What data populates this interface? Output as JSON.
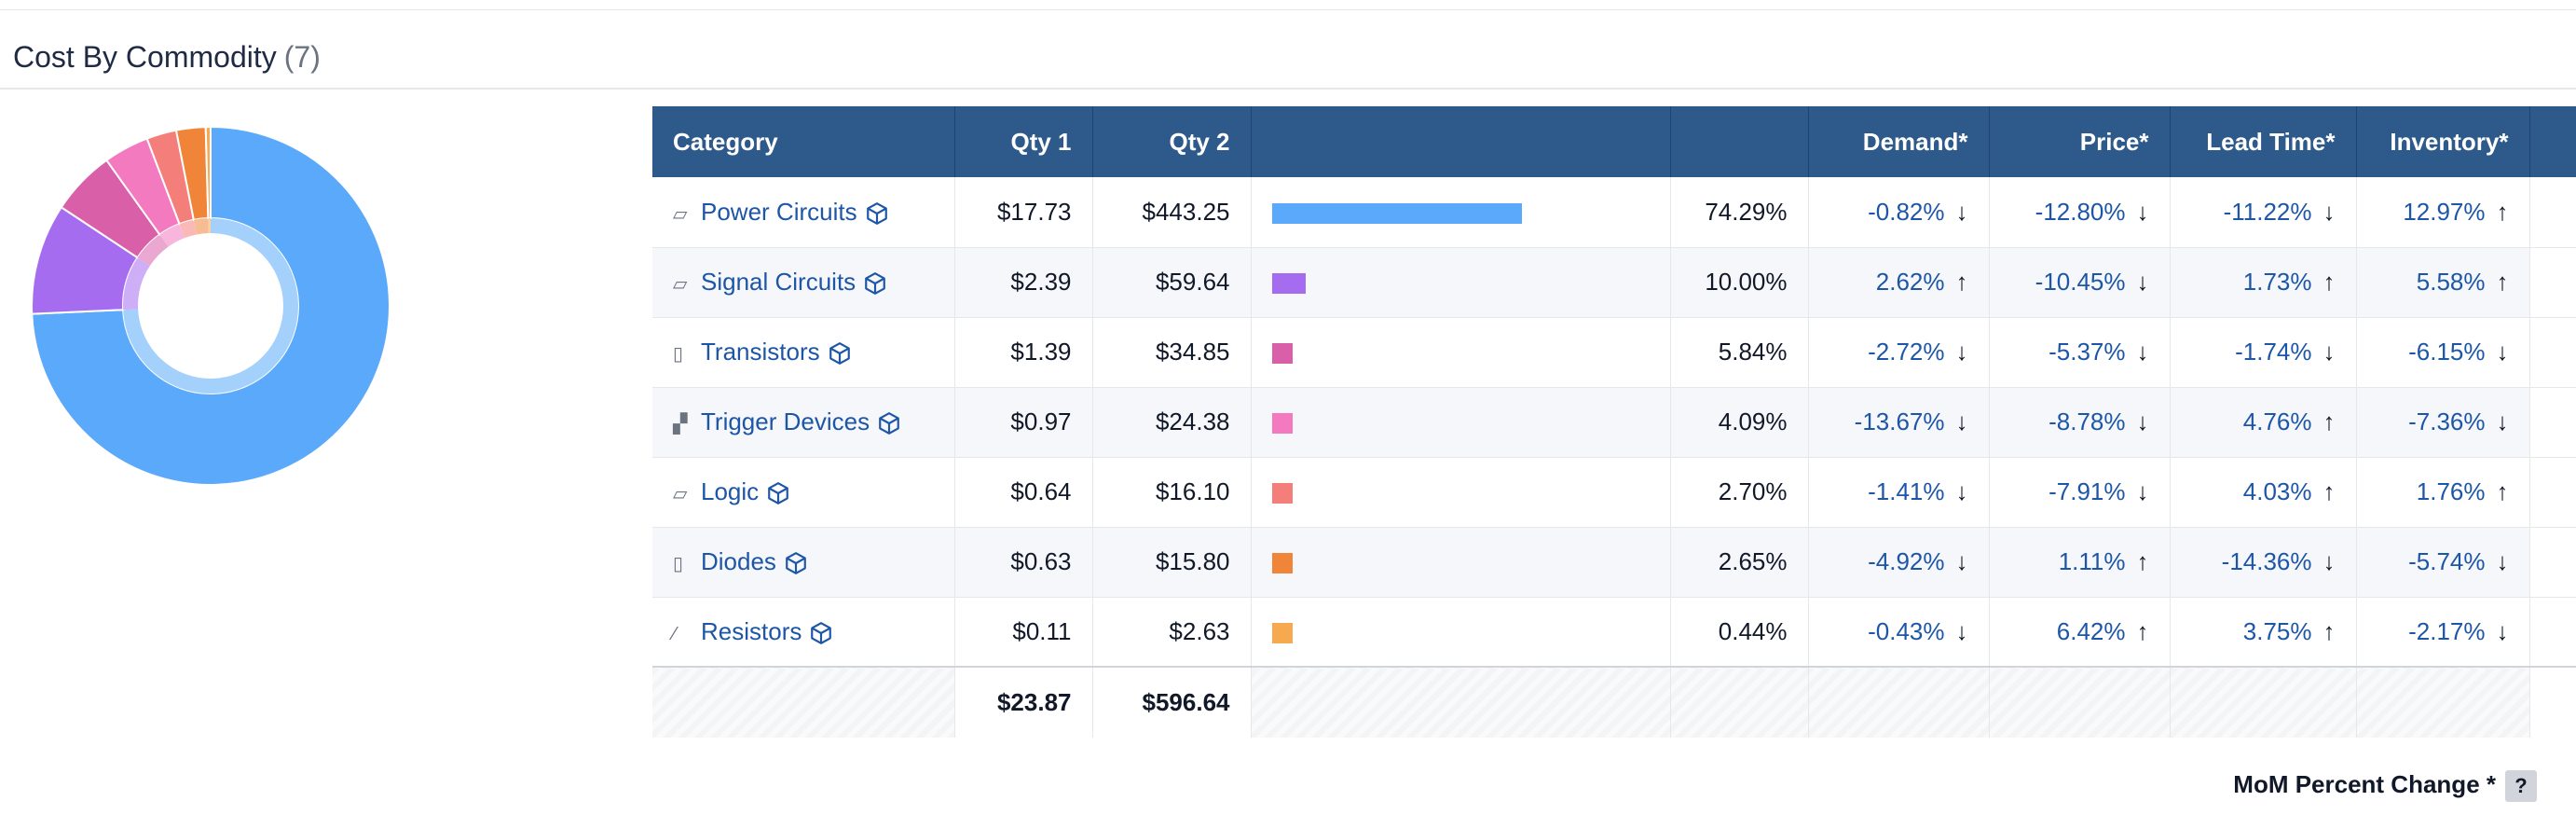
{
  "header": {
    "title": "Cost By Commodity",
    "count": "(7)"
  },
  "colors": {
    "header_bg": "#2d5a8a",
    "link": "#1d56a6",
    "series": [
      "#5aa9fa",
      "#a66cf0",
      "#d95fa8",
      "#f47ac0",
      "#f47f7a",
      "#f0853a",
      "#f6a94f"
    ]
  },
  "table": {
    "columns": [
      "Category",
      "Qty 1",
      "Qty 2",
      "",
      "",
      "Demand*",
      "Price*",
      "Lead Time*",
      "Inventory*"
    ],
    "rows": [
      {
        "icon": "power-circuit-icon",
        "glyph": "▱",
        "category": "Power Circuits",
        "qty1": "$17.73",
        "qty2": "$443.25",
        "share": 0.7429,
        "pct": "74.29%",
        "demand": "-0.82%",
        "demand_dir": "↓",
        "price": "-12.80%",
        "price_dir": "↓",
        "lead": "-11.22%",
        "lead_dir": "↓",
        "inventory": "12.97%",
        "inventory_dir": "↑"
      },
      {
        "icon": "signal-circuit-icon",
        "glyph": "▱",
        "category": "Signal Circuits",
        "qty1": "$2.39",
        "qty2": "$59.64",
        "share": 0.1,
        "pct": "10.00%",
        "demand": "2.62%",
        "demand_dir": "↑",
        "price": "-10.45%",
        "price_dir": "↓",
        "lead": "1.73%",
        "lead_dir": "↑",
        "inventory": "5.58%",
        "inventory_dir": "↑"
      },
      {
        "icon": "transistor-icon",
        "glyph": "▯",
        "category": "Transistors",
        "qty1": "$1.39",
        "qty2": "$34.85",
        "share": 0.0584,
        "pct": "5.84%",
        "demand": "-2.72%",
        "demand_dir": "↓",
        "price": "-5.37%",
        "price_dir": "↓",
        "lead": "-1.74%",
        "lead_dir": "↓",
        "inventory": "-6.15%",
        "inventory_dir": "↓"
      },
      {
        "icon": "trigger-device-icon",
        "glyph": "▞",
        "category": "Trigger Devices",
        "qty1": "$0.97",
        "qty2": "$24.38",
        "share": 0.0409,
        "pct": "4.09%",
        "demand": "-13.67%",
        "demand_dir": "↓",
        "price": "-8.78%",
        "price_dir": "↓",
        "lead": "4.76%",
        "lead_dir": "↑",
        "inventory": "-7.36%",
        "inventory_dir": "↓"
      },
      {
        "icon": "logic-icon",
        "glyph": "▱",
        "category": "Logic",
        "qty1": "$0.64",
        "qty2": "$16.10",
        "share": 0.027,
        "pct": "2.70%",
        "demand": "-1.41%",
        "demand_dir": "↓",
        "price": "-7.91%",
        "price_dir": "↓",
        "lead": "4.03%",
        "lead_dir": "↑",
        "inventory": "1.76%",
        "inventory_dir": "↑"
      },
      {
        "icon": "diode-icon",
        "glyph": "▯",
        "category": "Diodes",
        "qty1": "$0.63",
        "qty2": "$15.80",
        "share": 0.0265,
        "pct": "2.65%",
        "demand": "-4.92%",
        "demand_dir": "↓",
        "price": "1.11%",
        "price_dir": "↑",
        "lead": "-14.36%",
        "lead_dir": "↓",
        "inventory": "-5.74%",
        "inventory_dir": "↓"
      },
      {
        "icon": "resistor-icon",
        "glyph": "⁄",
        "category": "Resistors",
        "qty1": "$0.11",
        "qty2": "$2.63",
        "share": 0.0044,
        "pct": "0.44%",
        "demand": "-0.43%",
        "demand_dir": "↓",
        "price": "6.42%",
        "price_dir": "↑",
        "lead": "3.75%",
        "lead_dir": "↑",
        "inventory": "-2.17%",
        "inventory_dir": "↓"
      }
    ],
    "totals": {
      "qty1": "$23.87",
      "qty2": "$596.64"
    }
  },
  "chart_data": {
    "type": "pie",
    "categories": [
      "Power Circuits",
      "Signal Circuits",
      "Transistors",
      "Trigger Devices",
      "Logic",
      "Diodes",
      "Resistors"
    ],
    "values": [
      74.29,
      10.0,
      5.84,
      4.09,
      2.7,
      2.65,
      0.44
    ],
    "colors": [
      "#5aa9fa",
      "#a66cf0",
      "#d95fa8",
      "#f47ac0",
      "#f47f7a",
      "#f0853a",
      "#f6a94f"
    ],
    "donut": true
  },
  "footer": {
    "label": "MoM Percent Change *",
    "help": "?"
  }
}
